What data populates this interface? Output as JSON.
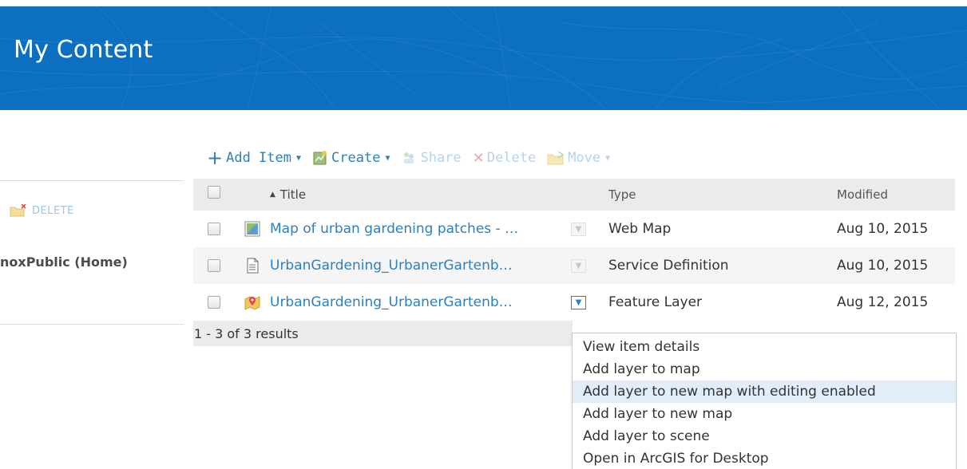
{
  "banner": {
    "title": "My Content",
    "color": "#0c6fc0"
  },
  "sidebar": {
    "delete_label": "DELETE",
    "folder_label": "noxPublic (Home)"
  },
  "toolbar": {
    "add_item": "Add Item",
    "create": "Create",
    "share": "Share",
    "delete": "Delete",
    "move": "Move"
  },
  "table": {
    "columns": {
      "title": "Title",
      "type": "Type",
      "modified": "Modified"
    },
    "rows": [
      {
        "title": "Map of urban gardening patches - …",
        "type": "Web Map",
        "modified": "Aug 10, 2015",
        "icon": "web-map-icon"
      },
      {
        "title": "UrbanGardening_UrbanerGartenb…",
        "type": "Service Definition",
        "modified": "Aug 10, 2015",
        "icon": "document-icon"
      },
      {
        "title": "UrbanGardening_UrbanerGartenb…",
        "type": "Feature Layer",
        "modified": "Aug 12, 2015",
        "icon": "feature-layer-icon"
      }
    ],
    "results": "1 - 3 of 3 results"
  },
  "menu": {
    "items": [
      "View item details",
      "Add layer to map",
      "Add layer to new map with editing enabled",
      "Add layer to new map",
      "Add layer to scene",
      "Open in ArcGIS for Desktop"
    ],
    "hovered": "Add layer to new map with editing enabled"
  },
  "colors": {
    "link": "#2b80c2",
    "disabled": "#b6d3ee",
    "hover": "#e1eefa"
  }
}
